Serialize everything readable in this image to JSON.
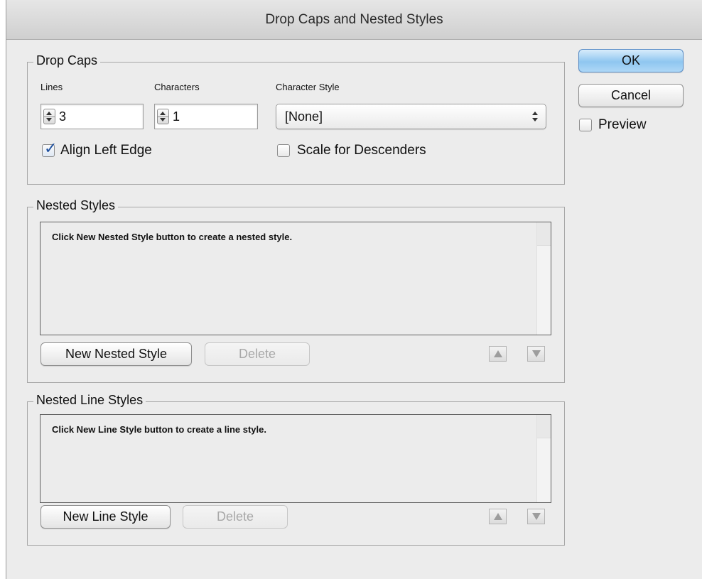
{
  "window": {
    "title": "Drop Caps and Nested Styles"
  },
  "drop_caps": {
    "legend": "Drop Caps",
    "lines_label": "Lines",
    "lines_value": "3",
    "characters_label": "Characters",
    "characters_value": "1",
    "character_style_label": "Character Style",
    "character_style_value": "[None]",
    "align_left_edge_label": "Align Left Edge",
    "align_left_edge_checked": true,
    "scale_for_descenders_label": "Scale for Descenders",
    "scale_for_descenders_checked": false
  },
  "nested_styles": {
    "legend": "Nested Styles",
    "empty_message": "Click New Nested Style button to create a nested style.",
    "new_button": "New Nested Style",
    "delete_button": "Delete"
  },
  "nested_line_styles": {
    "legend": "Nested Line Styles",
    "empty_message": "Click New Line Style button to create a line style.",
    "new_button": "New Line Style",
    "delete_button": "Delete"
  },
  "actions": {
    "ok_label": "OK",
    "cancel_label": "Cancel",
    "preview_label": "Preview",
    "preview_checked": false
  },
  "colors": {
    "ok_button": "#8fc6f0",
    "background": "#ececec"
  },
  "icons": {
    "spinner": "stepper-arrows-icon",
    "select": "select-arrows-icon",
    "move_up": "triangle-up-icon",
    "move_down": "triangle-down-icon"
  }
}
